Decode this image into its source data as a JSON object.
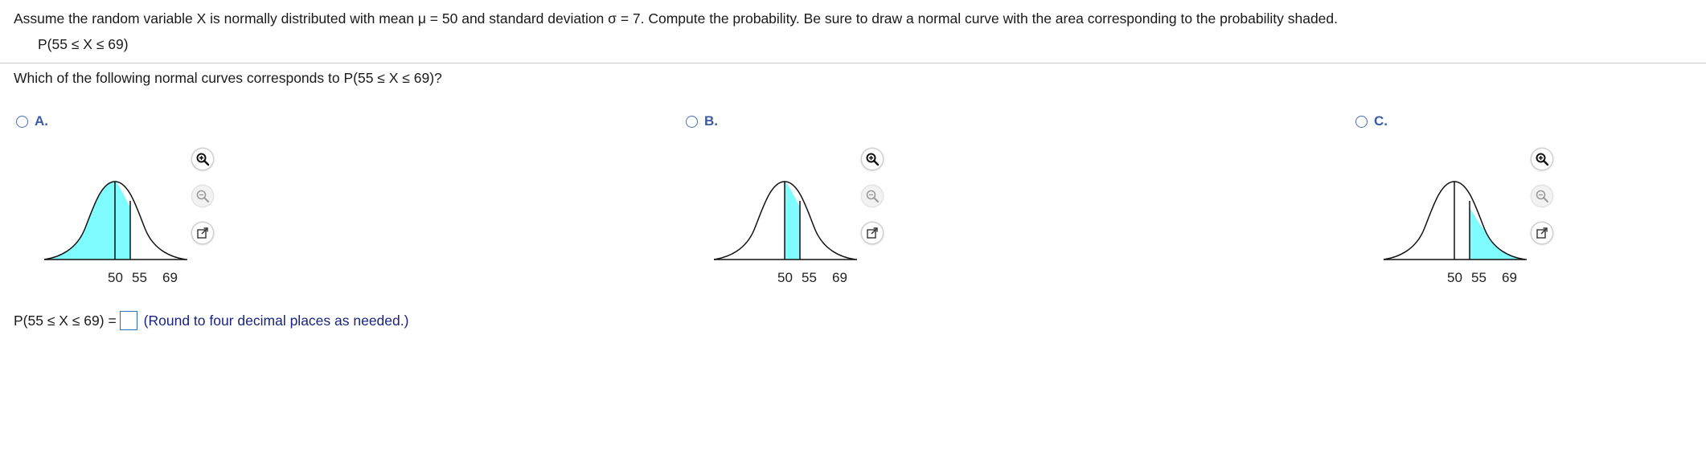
{
  "question": {
    "text": "Assume the random variable X is normally distributed with mean μ = 50 and standard deviation σ = 7. Compute the probability. Be sure to draw a normal curve with the area corresponding to the probability shaded.",
    "expression": "P(55 ≤ X ≤ 69)"
  },
  "prompt": "Which of the following normal curves corresponds to P(55 ≤ X ≤ 69)?",
  "choices": [
    {
      "letter": "A.",
      "shading": "left of 55",
      "ticks": [
        "50",
        "55",
        "69"
      ]
    },
    {
      "letter": "B.",
      "shading": "between 50 and 55",
      "ticks": [
        "50",
        "55",
        "69"
      ]
    },
    {
      "letter": "C.",
      "shading": "right of 55",
      "ticks": [
        "50",
        "55",
        "69"
      ]
    }
  ],
  "tools": {
    "zoom_in_icon": "zoom-in-icon",
    "zoom_out_icon": "zoom-out-icon",
    "popout_icon": "popout-icon"
  },
  "answer": {
    "label": "P(55 ≤ X ≤ 69) =",
    "value": "",
    "hint": "(Round to four decimal places as needed.)"
  },
  "colors": {
    "shade": "#7ffcff",
    "radio": "#4a6fb5",
    "letter": "#3a5ca8",
    "hint": "#1a237e",
    "input_border": "#2a6fb0"
  }
}
